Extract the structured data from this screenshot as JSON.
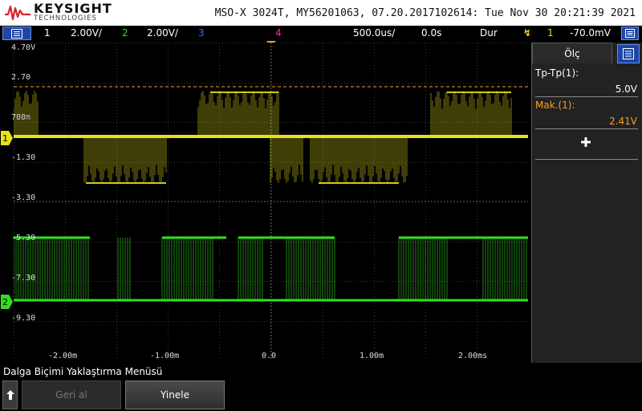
{
  "header": {
    "brand": "KEYSIGHT",
    "brand_sub": "TECHNOLOGIES",
    "device_info": "MSO-X 3024T, MY56201063, 07.20.2017102614: Tue Nov 30 20:21:39 2021"
  },
  "channels": {
    "ch1_num": "1",
    "ch1_scale": "2.00V/",
    "ch2_num": "2",
    "ch2_scale": "2.00V/",
    "ch3_num": "3",
    "ch4_num": "4",
    "timebase": "500.0us/",
    "delay": "0.0s",
    "mode": "Dur",
    "trigger_source": "1",
    "trigger_level": "-70.0mV"
  },
  "axis": {
    "volts": [
      "4.70V",
      "2.70",
      "700m",
      "-1.30",
      "-3.30",
      "-5.30",
      "-7.30",
      "-9.30"
    ],
    "time": [
      "-2.00m",
      "-1.00m",
      "0.0",
      "1.00m",
      "2.00ms"
    ]
  },
  "markers": {
    "ch1": "1",
    "ch2": "2"
  },
  "colors": {
    "ch1": "#e6e218",
    "ch2": "#33dd22",
    "ch3": "#3a6cff",
    "ch4": "#ff2a8a",
    "accent": "#ff9f1c",
    "menu_blue": "#1e46a8"
  },
  "panel": {
    "tab": "Ölç",
    "m1_label": "Tp-Tp(1):",
    "m1_value": "5.0V",
    "m2_label": "Mak.(1):",
    "m2_value": "2.41V"
  },
  "softmenu": {
    "title": "Dalga Biçimi Yaklaştırma Menüsü",
    "back": "Geri al",
    "refresh": "Yinele"
  }
}
